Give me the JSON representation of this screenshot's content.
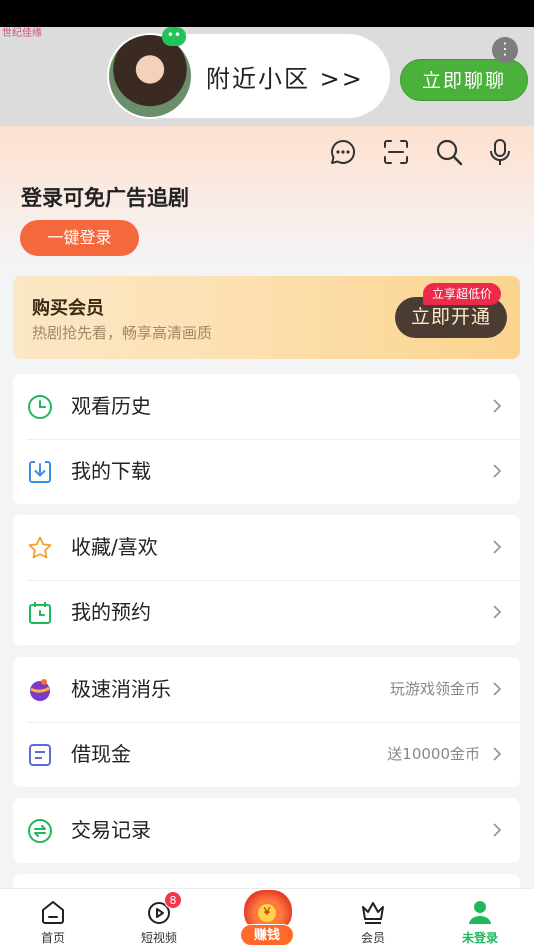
{
  "ad": {
    "watermark": "世纪佳缘",
    "pill_text": "附近小区 >>",
    "chat_button": "立即聊聊",
    "avatar_badge": "••",
    "more_icon": "more-vertical-icon"
  },
  "header": {
    "icons": [
      "message-icon",
      "scan-icon",
      "search-icon",
      "microphone-icon"
    ],
    "login_title": "登录可免广告追剧",
    "login_button": "一键登录"
  },
  "vip": {
    "title": "购买会员",
    "subtitle": "热剧抢先看，畅享高清画质",
    "button": "立即开通",
    "tag": "立享超低价"
  },
  "menu": {
    "group1": [
      {
        "icon": "clock-icon",
        "label": "观看历史"
      },
      {
        "icon": "download-icon",
        "label": "我的下载"
      }
    ],
    "group2": [
      {
        "icon": "star-icon",
        "label": "收藏/喜欢"
      },
      {
        "icon": "calendar-clock-icon",
        "label": "我的预约"
      }
    ],
    "group3": [
      {
        "icon": "game-ball-icon",
        "label": "极速消消乐",
        "extra": "玩游戏领金币"
      },
      {
        "icon": "cash-card-icon",
        "label": "借现金",
        "extra": "送10000金币"
      }
    ],
    "group4": [
      {
        "icon": "exchange-icon",
        "label": "交易记录"
      }
    ]
  },
  "bottom_nav": {
    "items": [
      {
        "icon": "home-icon",
        "label": "首页"
      },
      {
        "icon": "short-video-icon",
        "label": "短视频",
        "badge": "8"
      },
      {
        "icon": "money-bag-icon",
        "label": "赚钱",
        "coin": "￥"
      },
      {
        "icon": "crown-icon",
        "label": "会员"
      },
      {
        "icon": "user-icon",
        "label": "未登录"
      }
    ]
  },
  "colors": {
    "accent_green": "#1fb85a",
    "login_orange": "#f5683c",
    "vip_dark": "#4a3b33",
    "badge_red": "#f0364e"
  }
}
